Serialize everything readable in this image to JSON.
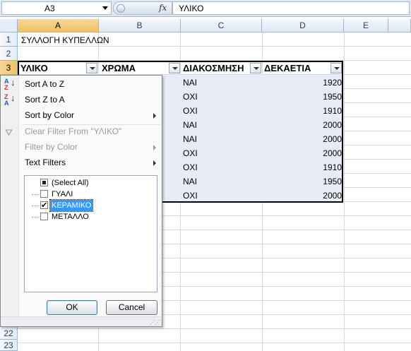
{
  "formula_bar": {
    "name_box": "A3",
    "fx_label": "fx",
    "formula": "ΥΛΙΚΟ"
  },
  "columns": [
    "A",
    "B",
    "C",
    "D",
    "E"
  ],
  "rows": [
    "1",
    "2",
    "3",
    "22",
    "23"
  ],
  "sheet": {
    "title": "ΣΥΛΛΟΓΗ ΚΥΠΕΛΛΩΝ",
    "headers": [
      "ΥΛΙΚΟ",
      "ΧΡΩΜΑ",
      "ΔΙΑΚΟΣΜΗΣΗ",
      "ΔΕΚΑΕΤΙΑ"
    ],
    "column_c": [
      "ΝΑΙ",
      "ΟΧΙ",
      "ΟΧΙ",
      "ΝΑΙ",
      "ΝΑΙ",
      "ΟΧΙ",
      "ΟΧΙ",
      "ΝΑΙ",
      "ΟΧΙ"
    ],
    "column_d": [
      "1920",
      "1950",
      "1910",
      "2000",
      "2000",
      "2000",
      "1910",
      "1950",
      "2000"
    ]
  },
  "filter_menu": {
    "sort_az": "Sort A to Z",
    "sort_za": "Sort Z to A",
    "sort_by_color": "Sort by Color",
    "clear_filter": "Clear Filter From \"ΥΛΙΚΟ\"",
    "filter_by_color": "Filter by Color",
    "text_filters": "Text Filters",
    "list": [
      {
        "label": "(Select All)",
        "state": "partial"
      },
      {
        "label": "ΓΥΑΛΙ",
        "state": "unchecked"
      },
      {
        "label": "ΚΕΡΑΜΙΚΟ",
        "state": "checked"
      },
      {
        "label": "ΜΕΤΑΛΛΟ",
        "state": "unchecked"
      }
    ],
    "ok": "OK",
    "cancel": "Cancel"
  }
}
